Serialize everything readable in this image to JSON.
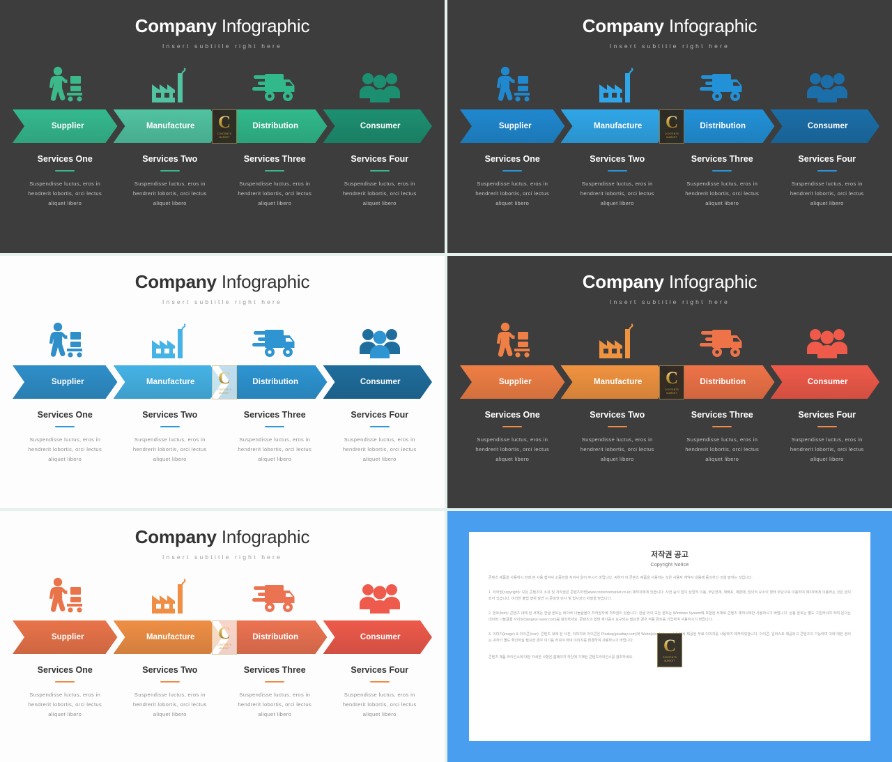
{
  "slides": [
    {
      "id": "green-dark",
      "theme": "dark",
      "title_bold": "Company",
      "title_light": " Infographic",
      "subtitle": "Insert subtitle right here",
      "icon_color": "#3cb88a",
      "rule_color": "#3cb88a",
      "steps": [
        {
          "label": "Supplier",
          "icon": "worker-handtruck-icon",
          "color": "#35b98e"
        },
        {
          "label": "Manufacture",
          "icon": "factory-icon",
          "color": "#51c3a1"
        },
        {
          "label": "Distribution",
          "icon": "delivery-truck-icon",
          "color": "#31b98c"
        },
        {
          "label": "Consumer",
          "icon": "people-group-icon",
          "color": "#1d8f71"
        }
      ],
      "services": [
        {
          "title": "Services One",
          "body": "Suspendisse luctus, eros in hendrerit lobortis, orci lectus aliquet libero"
        },
        {
          "title": "Services Two",
          "body": "Suspendisse luctus, eros in hendrerit lobortis, orci lectus aliquet libero"
        },
        {
          "title": "Services Three",
          "body": "Suspendisse luctus, eros in hendrerit lobortis, orci lectus aliquet libero"
        },
        {
          "title": "Services Four",
          "body": "Suspendisse luctus, eros in hendrerit lobortis, orci lectus aliquet libero"
        }
      ]
    },
    {
      "id": "blue-dark",
      "theme": "dark",
      "title_bold": "Company",
      "title_light": " Infographic",
      "subtitle": "Insert subtitle right here",
      "icon_color": "#2b96d8",
      "rule_color": "#2b96d8",
      "steps": [
        {
          "label": "Supplier",
          "icon": "worker-handtruck-icon",
          "color": "#2088cf"
        },
        {
          "label": "Manufacture",
          "icon": "factory-icon",
          "color": "#30a6e8"
        },
        {
          "label": "Distribution",
          "icon": "delivery-truck-icon",
          "color": "#2291d8"
        },
        {
          "label": "Consumer",
          "icon": "people-group-icon",
          "color": "#1b6ea8"
        }
      ],
      "services": [
        {
          "title": "Services One",
          "body": "Suspendisse luctus, eros in hendrerit lobortis, orci lectus aliquet libero"
        },
        {
          "title": "Services Two",
          "body": "Suspendisse luctus, eros in hendrerit lobortis, orci lectus aliquet libero"
        },
        {
          "title": "Services Three",
          "body": "Suspendisse luctus, eros in hendrerit lobortis, orci lectus aliquet libero"
        },
        {
          "title": "Services Four",
          "body": "Suspendisse luctus, eros in hendrerit lobortis, orci lectus aliquet libero"
        }
      ]
    },
    {
      "id": "blue-light",
      "theme": "light",
      "title_bold": "Company",
      "title_light": " Infographic",
      "subtitle": "Insert subtitle right here",
      "icon_color": "#2b96d8",
      "rule_color": "#2b96d8",
      "steps": [
        {
          "label": "Supplier",
          "icon": "worker-handtruck-icon",
          "color": "#2f8fc9"
        },
        {
          "label": "Manufacture",
          "icon": "factory-icon",
          "color": "#45b3e6"
        },
        {
          "label": "Distribution",
          "icon": "delivery-truck-icon",
          "color": "#2e95d2"
        },
        {
          "label": "Consumer",
          "icon": "people-group-icon",
          "color": "#1f6d9c"
        }
      ],
      "services": [
        {
          "title": "Services One",
          "body": "Suspendisse luctus, eros in hendrerit lobortis, orci lectus aliquet libero"
        },
        {
          "title": "Services Two",
          "body": "Suspendisse luctus, eros in hendrerit lobortis, orci lectus aliquet libero"
        },
        {
          "title": "Services Three",
          "body": "Suspendisse luctus, eros in hendrerit lobortis, orci lectus aliquet libero"
        },
        {
          "title": "Services Four",
          "body": "Suspendisse luctus, eros in hendrerit lobortis, orci lectus aliquet libero"
        }
      ]
    },
    {
      "id": "orange-dark",
      "theme": "dark",
      "title_bold": "Company",
      "title_light": " Infographic",
      "subtitle": "Insert subtitle right here",
      "icon_color": "#ef8b43",
      "rule_color": "#ef8b43",
      "steps": [
        {
          "label": "Supplier",
          "icon": "worker-handtruck-icon",
          "color": "#ef7f45"
        },
        {
          "label": "Manufacture",
          "icon": "factory-icon",
          "color": "#f09340"
        },
        {
          "label": "Distribution",
          "icon": "delivery-truck-icon",
          "color": "#ee7348"
        },
        {
          "label": "Consumer",
          "icon": "people-group-icon",
          "color": "#ef5a4a"
        }
      ],
      "services": [
        {
          "title": "Services One",
          "body": "Suspendisse luctus, eros in hendrerit lobortis, orci lectus aliquet libero"
        },
        {
          "title": "Services Two",
          "body": "Suspendisse luctus, eros in hendrerit lobortis, orci lectus aliquet libero"
        },
        {
          "title": "Services Three",
          "body": "Suspendisse luctus, eros in hendrerit lobortis, orci lectus aliquet libero"
        },
        {
          "title": "Services Four",
          "body": "Suspendisse luctus, eros in hendrerit lobortis, orci lectus aliquet libero"
        }
      ]
    },
    {
      "id": "orange-light",
      "theme": "light",
      "title_bold": "Company",
      "title_light": " Infographic",
      "subtitle": "Insert subtitle right here",
      "icon_color": "#ef8b43",
      "rule_color": "#ef8b43",
      "steps": [
        {
          "label": "Supplier",
          "icon": "worker-handtruck-icon",
          "color": "#e9744a"
        },
        {
          "label": "Manufacture",
          "icon": "factory-icon",
          "color": "#ef8f45"
        },
        {
          "label": "Distribution",
          "icon": "delivery-truck-icon",
          "color": "#ec7352"
        },
        {
          "label": "Consumer",
          "icon": "people-group-icon",
          "color": "#ee5a4b"
        }
      ],
      "services": [
        {
          "title": "Services One",
          "body": "Suspendisse luctus, eros in hendrerit lobortis, orci lectus aliquet libero"
        },
        {
          "title": "Services Two",
          "body": "Suspendisse luctus, eros in hendrerit lobortis, orci lectus aliquet libero"
        },
        {
          "title": "Services Three",
          "body": "Suspendisse luctus, eros in hendrerit lobortis, orci lectus aliquet libero"
        },
        {
          "title": "Services Four",
          "body": "Suspendisse luctus, eros in hendrerit lobortis, orci lectus aliquet libero"
        }
      ]
    }
  ],
  "watermark": {
    "letter": "C",
    "caption": "CONTENTS\\nMARKET"
  },
  "copyright": {
    "frame_color": "#4a9ef0",
    "title_kr": "저작권 공고",
    "title_en": "Copyright Notice",
    "intro": "콘텐츠 제품을 사용하시 전에 본 사용 협약서 소중한을 지켜서 읽어 주시기 바랍니다. 귀하가 이 콘텐츠 제품을 사용하는 것은 사용자 계약서 내용에 동의하신 것을 말하는 것입니다.",
    "p1": "1. 저작권(copyright): 모든 콘텐츠의 소유 및 저작권은 콘텐츠마켓(www.contentsmarket.co.kr) 제작자에게 있습니다. 사전 승낙 없이 상업적 이용, 무단전재, 재배포, 재판매, 임의적 요소의 형태 무단으로 이용하여 제3자에게 이용하는 것은 금지되어 있습니다. 이러한 불법 행위 발견 시 준엄한 민사 및 형사상의 처벌을 받습니다.",
    "p2": "2. 폰트(font): 콘텐츠 내에 된 서체는 한글 폰트는 네이버 나눔글꼴의 저작권자에 저작권이 있습니다. 한글 외의 모든 폰트는 Windows System에 포함된 서체로 콘텐츠 제작시에만 사용하시기 바랍니다. 상용 폰트는 별도 구입하셔야 하며 문의는 네이버 나눔글꼴 사이트(hangeul.naver.com)를 참조하세요. 콘텐츠의 형태 재가공시 요구되는 필요한 경우 적용 폰트를 기입하여 사용하시기 바랍니다.",
    "p3": "3. 이미지(image) & 아이콘(icon): 콘텐츠 내에 된 사진, 이미지와 아이콘은 Pixabay(pixabay.com)와 Weboly(weboly.com) 등에서 제공된 무료 이미지를 사용하여 제작되었습니다. 아이콘, 일러스트 제공되고 콘텐츠의 기능하며 이에 대한 권리는 귀하가 별도 확인하실 필요한 경우 여기를 하셔야 하며 이미지를 변경하여 사용하시기 바랍니다.",
    "footer": "콘텐츠 제품 라이선스에 대한 자세한 사항은 홈페이지 하단에 기재된 콘텐츠라이선스를 참조하세요."
  }
}
